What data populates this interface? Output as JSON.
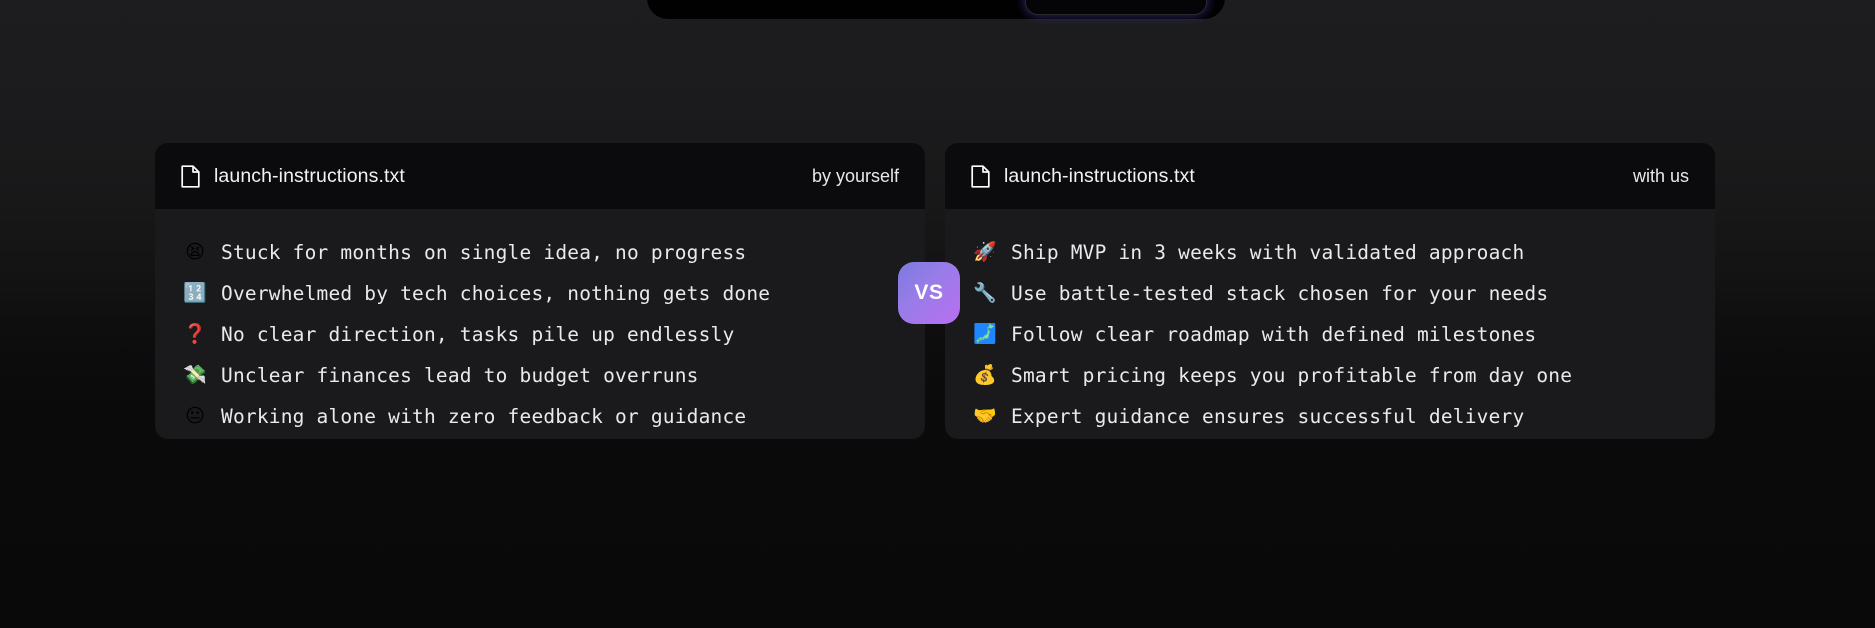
{
  "background": {
    "top_color": "#1d1d1f",
    "bottom_color": "#090909"
  },
  "top_clipped_panel": {
    "panel_color": "#010101",
    "chip_glow_color": "#6054dc"
  },
  "vs_badge": {
    "label": "VS",
    "gradient_from": "#7d7ae0",
    "gradient_to": "#b96ef0",
    "text_color": "#ffffff"
  },
  "panels": [
    {
      "id": "before",
      "icon": "file-icon",
      "filename": "launch-instructions.txt",
      "tag": "by yourself",
      "header_bg": "#0b0b0d",
      "body_bg": "#1a1a1c",
      "lines": [
        {
          "emoji": "😫",
          "emoji_name": "tired-face-emoji",
          "text": "Stuck for months on single idea, no progress"
        },
        {
          "emoji": "🔢",
          "emoji_name": "input-numbers-emoji",
          "text": "Overwhelmed by tech choices, nothing gets done"
        },
        {
          "emoji": "❓",
          "emoji_name": "red-question-mark-emoji",
          "text": "No clear direction, tasks pile up endlessly"
        },
        {
          "emoji": "💸",
          "emoji_name": "money-with-wings-emoji",
          "text": "Unclear finances lead to budget overruns"
        },
        {
          "emoji": "😐",
          "emoji_name": "neutral-face-emoji",
          "text": "Working alone with zero feedback or guidance"
        }
      ]
    },
    {
      "id": "after",
      "icon": "file-icon",
      "filename": "launch-instructions.txt",
      "tag": "with us",
      "header_bg": "#0b0b0d",
      "body_bg": "#1a1a1c",
      "lines": [
        {
          "emoji": "🚀",
          "emoji_name": "rocket-emoji",
          "text": "Ship MVP in 3 weeks with validated approach"
        },
        {
          "emoji": "🔧",
          "emoji_name": "wrench-emoji",
          "text": "Use battle-tested stack chosen for your needs"
        },
        {
          "emoji": "🗾",
          "emoji_name": "map-of-japan-emoji",
          "text": "Follow clear roadmap with defined milestones"
        },
        {
          "emoji": "💰",
          "emoji_name": "money-bag-emoji",
          "text": "Smart pricing keeps you profitable from day one"
        },
        {
          "emoji": "🤝",
          "emoji_name": "handshake-emoji",
          "text": "Expert guidance ensures successful delivery"
        }
      ]
    }
  ]
}
